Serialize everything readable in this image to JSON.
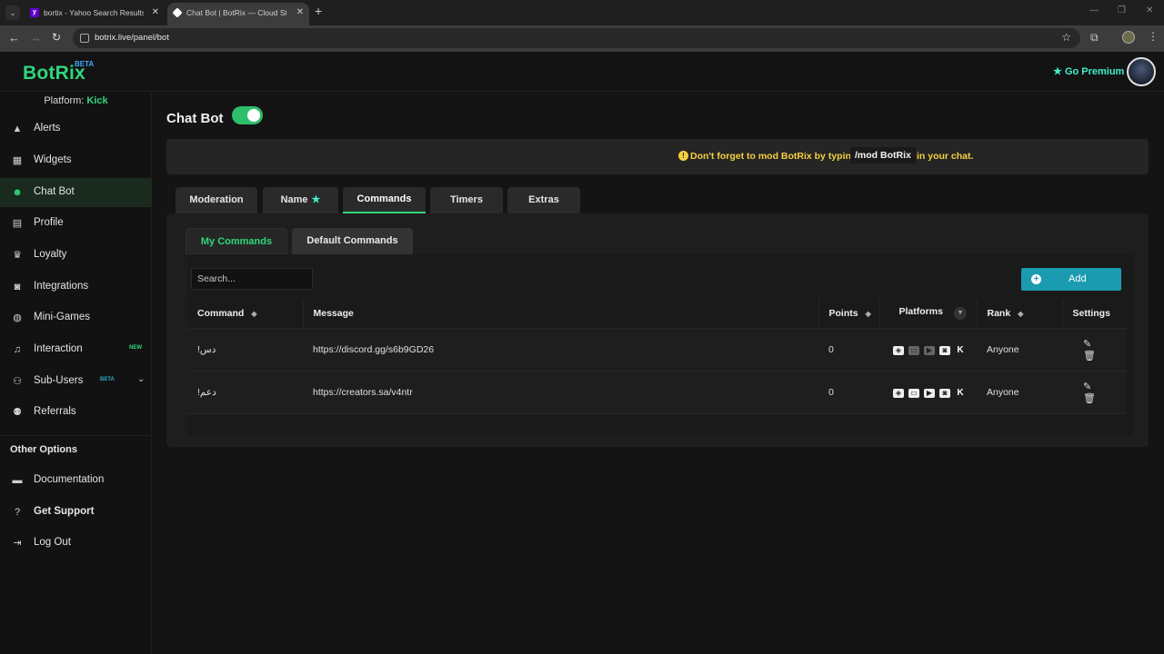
{
  "browser": {
    "tabs": [
      {
        "title": "bortix - Yahoo Search Results",
        "favicon": "yahoo-icon"
      },
      {
        "title": "Chat Bot | BotRix — Cloud Strea",
        "favicon": "botrix-icon"
      }
    ],
    "url": "botrix.live/panel/bot"
  },
  "header": {
    "logo": "BotRix",
    "logo_badge": "BETA",
    "premium_label": "Go Premium",
    "premium_color": "#41f0c9"
  },
  "sidebar": {
    "platform_label": "Platform:",
    "platform_value": "Kick",
    "items": [
      {
        "label": "Alerts",
        "icon": "warning-icon"
      },
      {
        "label": "Widgets",
        "icon": "widgets-icon"
      },
      {
        "label": "Chat Bot",
        "icon": "robot-icon",
        "active": true
      },
      {
        "label": "Profile",
        "icon": "id-card-icon"
      },
      {
        "label": "Loyalty",
        "icon": "trophy-icon"
      },
      {
        "label": "Integrations",
        "icon": "discord-icon"
      },
      {
        "label": "Mini-Games",
        "icon": "gamepad-icon"
      },
      {
        "label": "Interaction",
        "icon": "music-icon",
        "badge": "NEW"
      },
      {
        "label": "Sub-Users",
        "icon": "users-icon",
        "badge": "BETA"
      },
      {
        "label": "Referrals",
        "icon": "user-group-icon"
      }
    ],
    "other_options_title": "Other Options",
    "other_items": [
      {
        "label": "Documentation",
        "icon": "scroll-icon"
      },
      {
        "label": "Get Support",
        "icon": "question-icon"
      },
      {
        "label": "Log Out",
        "icon": "logout-icon"
      }
    ]
  },
  "main": {
    "title": "Chat Bot",
    "enabled": true,
    "notice": {
      "text_before": "Don't forget to mod BotRix by typing",
      "code": "/mod BotRix",
      "text_after": "in your chat."
    },
    "tabs": [
      "Moderation",
      "Name",
      "Commands",
      "Timers",
      "Extras"
    ],
    "active_tab": "Commands",
    "subtabs": [
      "My Commands",
      "Default Commands"
    ],
    "search_placeholder": "Search...",
    "add_label": "Add",
    "columns": [
      "Command",
      "Message",
      "Points",
      "Platforms",
      "Rank",
      "Settings"
    ],
    "rows": [
      {
        "command": "!دس",
        "message": "https://discord.gg/s6b9GD26",
        "points": "0",
        "rank": "Anyone",
        "youtube_enabled": false
      },
      {
        "command": "!دعم",
        "message": "https://creators.sa/v4ntr",
        "points": "0",
        "rank": "Anyone",
        "youtube_enabled": true
      }
    ]
  }
}
